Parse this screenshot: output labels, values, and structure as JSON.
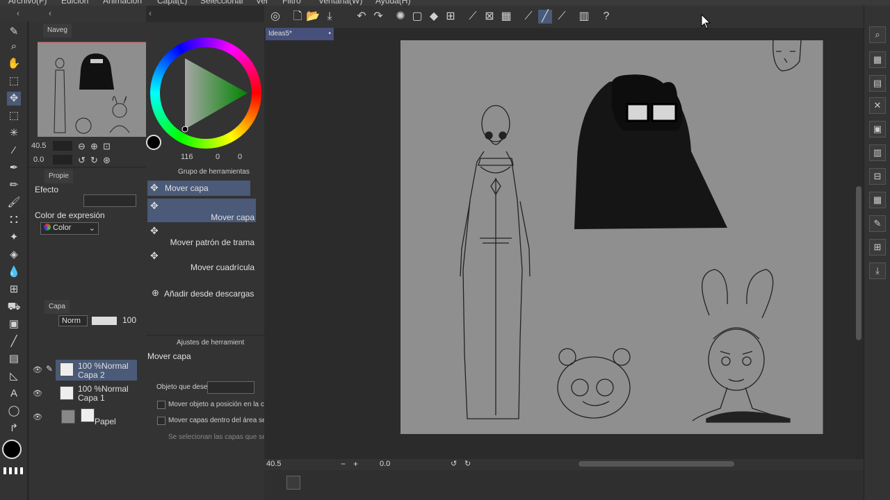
{
  "menu": [
    "Archivo(F)",
    "Edición",
    "Animación",
    "Capa(L)",
    "Seleccionar",
    "Ver",
    "Filtro",
    "Ventana(W)",
    "Ayuda(H)"
  ],
  "document_tab": "Ideas5*",
  "navigator": {
    "tab_label": "Naveg",
    "zoom": "40.5",
    "angle": "0.0"
  },
  "properties": {
    "tab_label": "Propie",
    "effect_label": "Efecto",
    "expression_color_label": "Color de expresión",
    "expression_color_value": "Color"
  },
  "color_panel": {
    "hue": "116",
    "sat": "0",
    "val": "0"
  },
  "tool_group": {
    "title": "Grupo de herramientas",
    "selected_group": "Mover capa",
    "subtools": [
      "Mover capa",
      "Mover patrón de trama",
      "Mover cuadrícula"
    ],
    "add_from_downloads": "Añadir desde descargas"
  },
  "layers": {
    "tab_label": "Capa",
    "blend_mode": "Norm",
    "opacity": "100",
    "items": [
      {
        "mode": "100 %Normal",
        "name": "Capa 2",
        "selected": true
      },
      {
        "mode": "100 %Normal",
        "name": "Capa 1",
        "selected": false
      },
      {
        "mode": "",
        "name": "Papel",
        "selected": false
      }
    ]
  },
  "tool_settings": {
    "tab_label": "Ajustes de herramient",
    "tool_name": "Mover capa",
    "target_label": "Objeto que dese",
    "option1": "Mover objeto a posición en la c",
    "option2": "Mover capas dentro del área se",
    "note": "Se selecionan las capas que se"
  },
  "status": {
    "zoom": "40.5",
    "angle": "0.0"
  },
  "colors": {
    "accent": "#4a5a78",
    "panel": "#333333",
    "paper": "#8f8f8f"
  }
}
